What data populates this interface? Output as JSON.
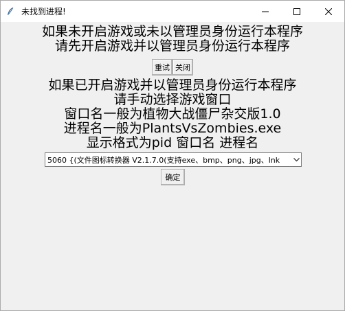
{
  "window": {
    "title": "未找到进程!",
    "icon": "feather-icon"
  },
  "message_block_1": {
    "lines": [
      "如果未开启游戏或未以管理员身份运行本程序",
      "请先开启游戏并以管理员身份运行本程序"
    ]
  },
  "buttons_row": {
    "retry_label": "重试",
    "close_label": "关闭"
  },
  "message_block_2": {
    "lines": [
      "如果已开启游戏并以管理员身份运行本程序",
      "请手动选择游戏窗口",
      "窗口名一般为植物大战僵尸杂交版1.0",
      "进程名一般为PlantsVsZombies.exe",
      "显示格式为pid 窗口名 进程名"
    ]
  },
  "process_select": {
    "selected_value": "5060 {(文件图标转换器 V2.1.7.0(支持exe、bmp、png、jpg、lnk"
  },
  "confirm_label": "确定"
}
